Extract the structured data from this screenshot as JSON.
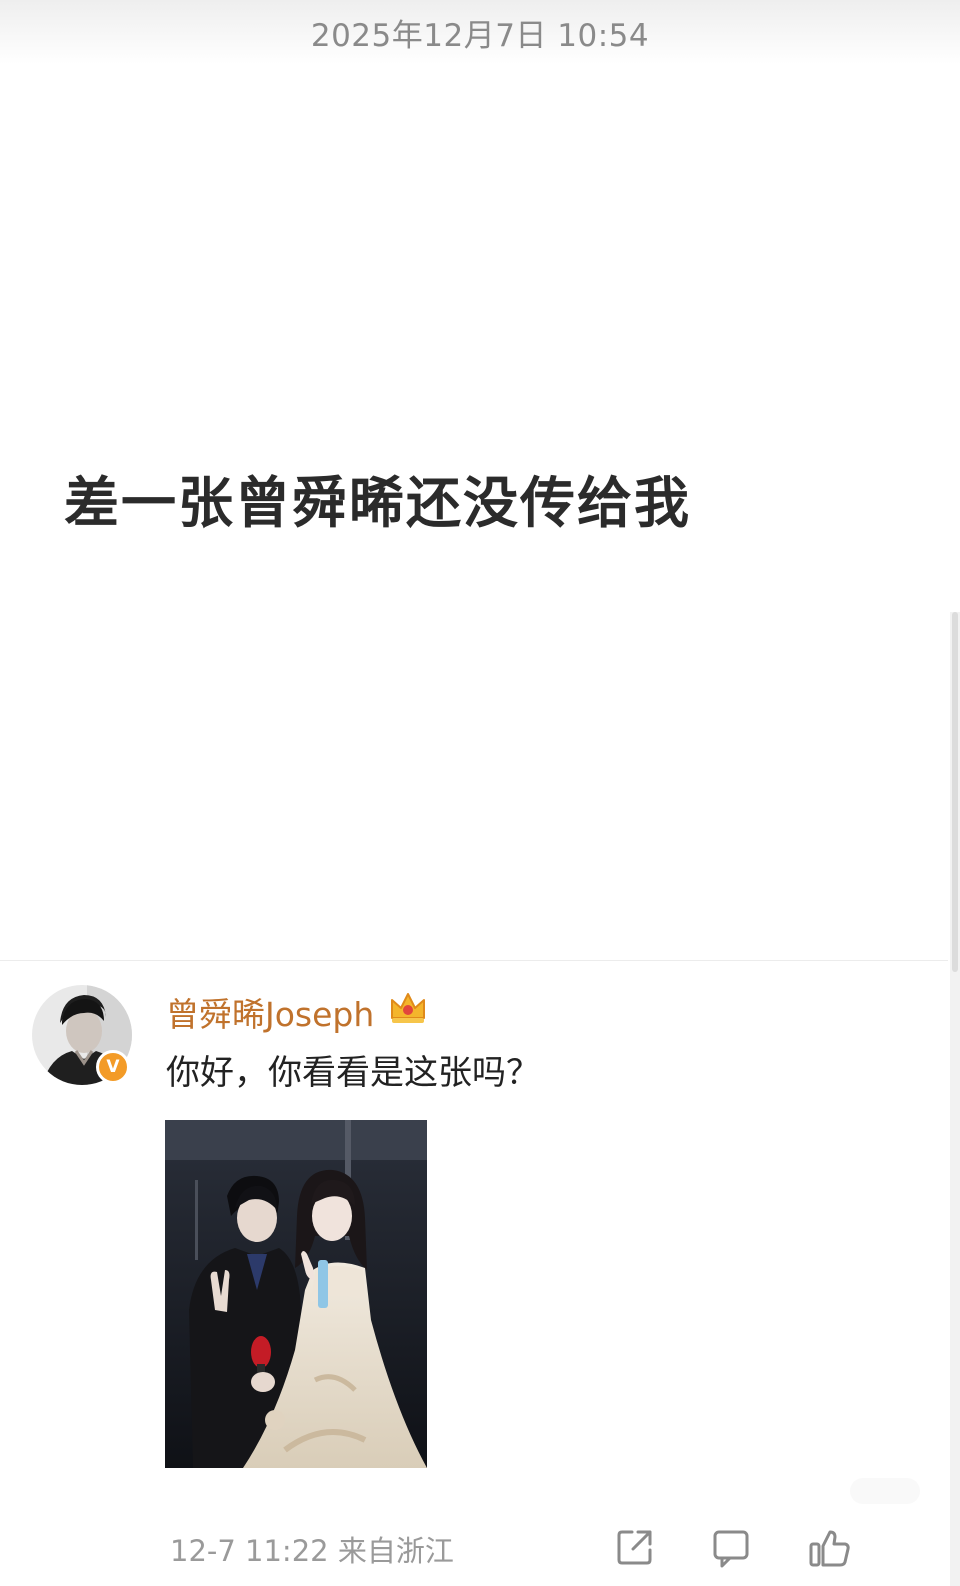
{
  "header": {
    "timestamp": "2025年12月7日 10:54"
  },
  "post": {
    "text": "差一张曾舜晞还没传给我"
  },
  "reply": {
    "username": "曾舜晞Joseph",
    "verified_badge": "V",
    "text": "你好，你看看是这张吗？",
    "footer_meta": "12-7 11:22 来自浙江"
  },
  "icons": [
    "crown-icon",
    "verified-icon",
    "share-icon",
    "comment-icon",
    "like-icon"
  ],
  "colors": {
    "username": "#c0722c",
    "verified": "#f39b27",
    "text": "#222222",
    "meta": "#9a9a9a"
  }
}
